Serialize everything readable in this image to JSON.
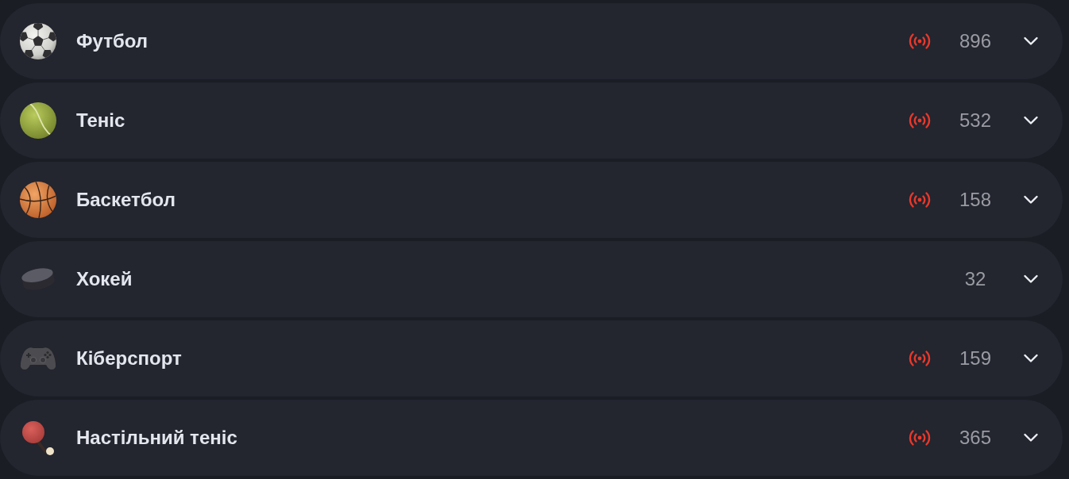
{
  "sports": [
    {
      "kind": "football",
      "name": "Футбол",
      "live": true,
      "count": "896",
      "expanded": false
    },
    {
      "kind": "tennis",
      "name": "Теніс",
      "live": true,
      "count": "532",
      "expanded": false
    },
    {
      "kind": "basketball",
      "name": "Баскетбол",
      "live": true,
      "count": "158",
      "expanded": false
    },
    {
      "kind": "hockey",
      "name": "Хокей",
      "live": false,
      "count": "32",
      "expanded": false
    },
    {
      "kind": "esports",
      "name": "Кіберспорт",
      "live": true,
      "count": "159",
      "expanded": false
    },
    {
      "kind": "tabletennis",
      "name": "Настільний теніс",
      "live": true,
      "count": "365",
      "expanded": false
    }
  ]
}
